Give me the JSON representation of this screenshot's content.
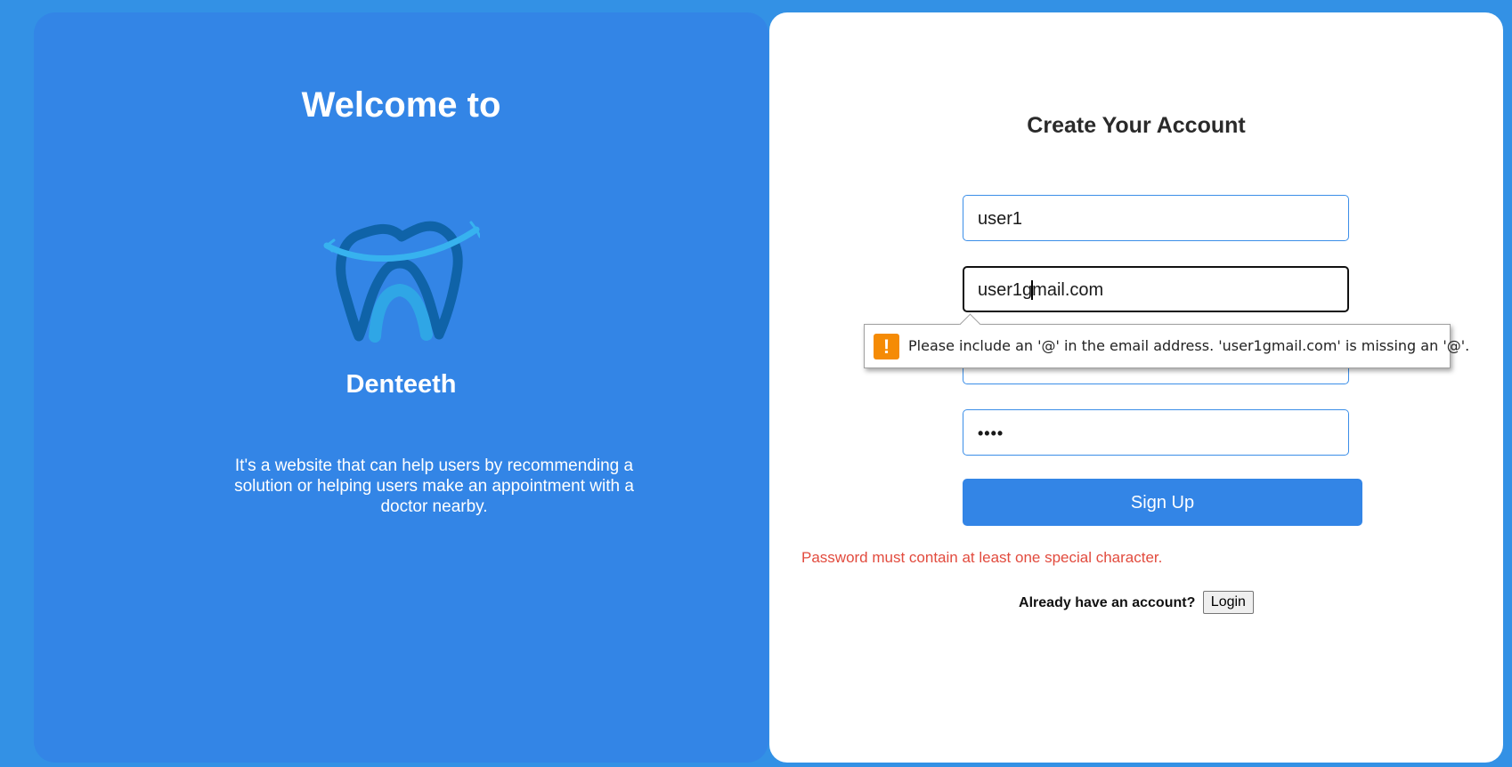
{
  "colors": {
    "background": "#3391e5",
    "left_panel": "#3385e6",
    "right_panel": "#ffffff",
    "button": "#3385e6",
    "error": "#e24b3e",
    "warning_icon": "#f58b05"
  },
  "welcome": {
    "title": "Welcome to",
    "logo_icon": "tooth-smile-icon",
    "brand_name": "Denteeth",
    "description": "It's a website that can help users by recommending a solution or helping users make an appointment with a doctor nearby."
  },
  "form": {
    "title": "Create Your Account",
    "username_value": "user1",
    "email_value_before_caret": "user1g",
    "email_value_after_caret": "mail.com",
    "password_masked": "••••",
    "signup_label": "Sign Up",
    "error_message": "Password must contain at least one special character.",
    "login_prompt": "Already have an account?",
    "login_label": "Login"
  },
  "validation_tooltip": {
    "icon": "warning-icon",
    "icon_glyph": "!",
    "message": "Please include an '@' in the email address. 'user1gmail.com' is missing an '@'."
  }
}
